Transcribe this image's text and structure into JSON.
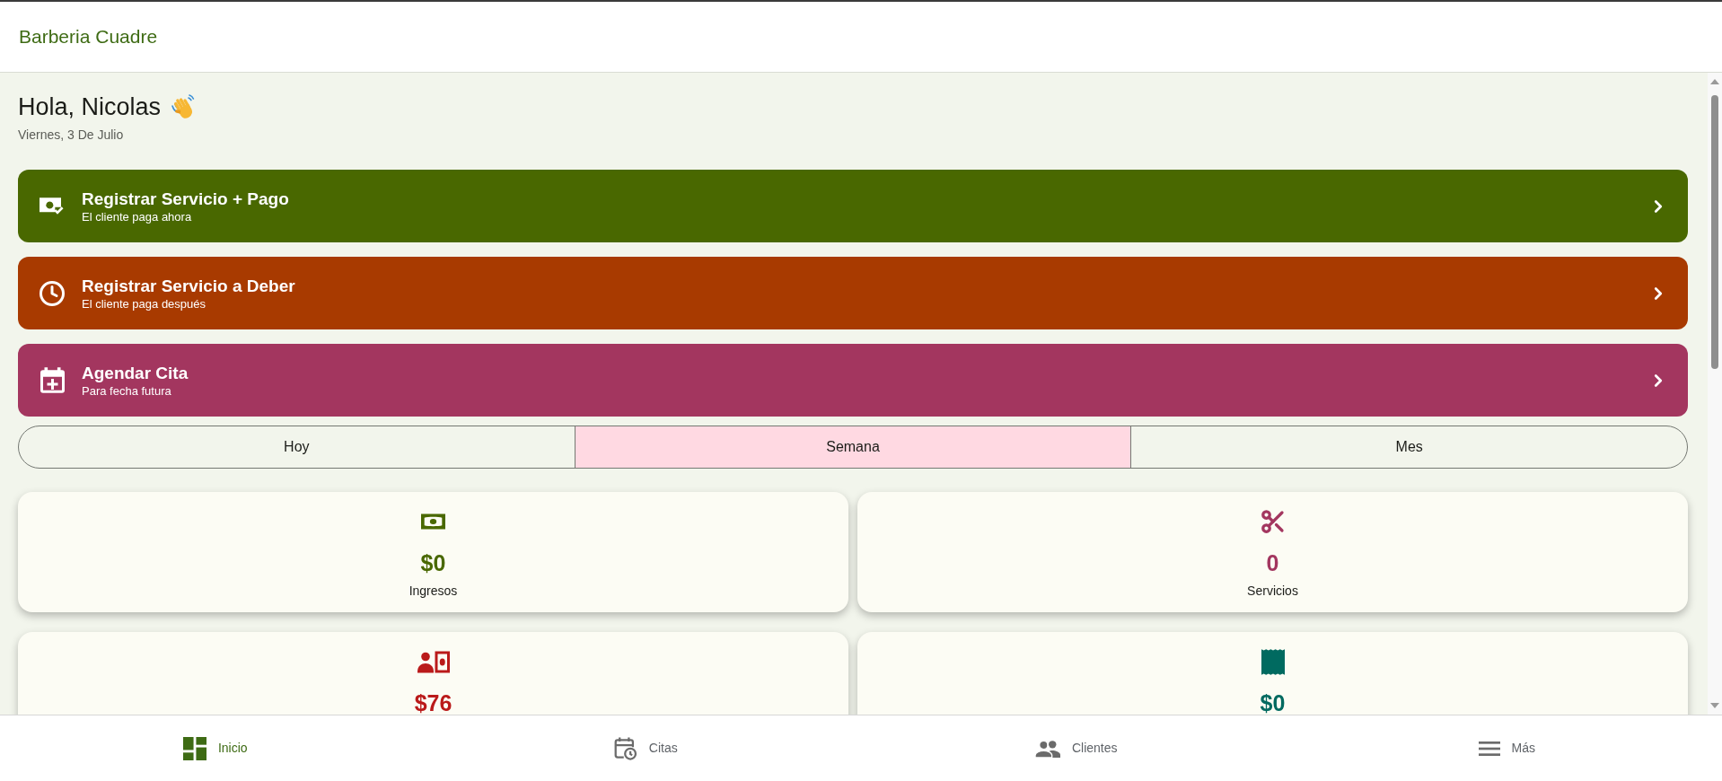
{
  "app_bar": {
    "title": "Barberia Cuadre"
  },
  "greeting": {
    "title": "Hola, Nicolas",
    "date": "Viernes, 3 De Julio"
  },
  "actions": [
    {
      "kind": "pay",
      "title": "Registrar Servicio + Pago",
      "subtitle": "El cliente paga ahora",
      "color": "#496800"
    },
    {
      "kind": "debt",
      "title": "Registrar Servicio a Deber",
      "subtitle": "El cliente paga después",
      "color": "#a83a00"
    },
    {
      "kind": "appointment",
      "title": "Agendar Cita",
      "subtitle": "Para fecha futura",
      "color": "#a3365f"
    }
  ],
  "period_tabs": [
    {
      "label": "Hoy",
      "selected": false
    },
    {
      "label": "Semana",
      "selected": true
    },
    {
      "label": "Mes",
      "selected": false
    }
  ],
  "stats": [
    {
      "kind": "income",
      "value": "$0",
      "label": "Ingresos",
      "color": "#496800"
    },
    {
      "kind": "services",
      "value": "0",
      "label": "Servicios",
      "color": "#a3365f"
    },
    {
      "kind": "debt",
      "value": "$76",
      "color": "#ba1a1a"
    },
    {
      "kind": "receipts",
      "value": "$0",
      "color": "#006a60"
    }
  ],
  "bottom_nav": [
    {
      "kind": "home",
      "label": "Inicio",
      "selected": true
    },
    {
      "kind": "appointments",
      "label": "Citas",
      "selected": false
    },
    {
      "kind": "clients",
      "label": "Clientes",
      "selected": false
    },
    {
      "kind": "more",
      "label": "Más",
      "selected": false
    }
  ]
}
